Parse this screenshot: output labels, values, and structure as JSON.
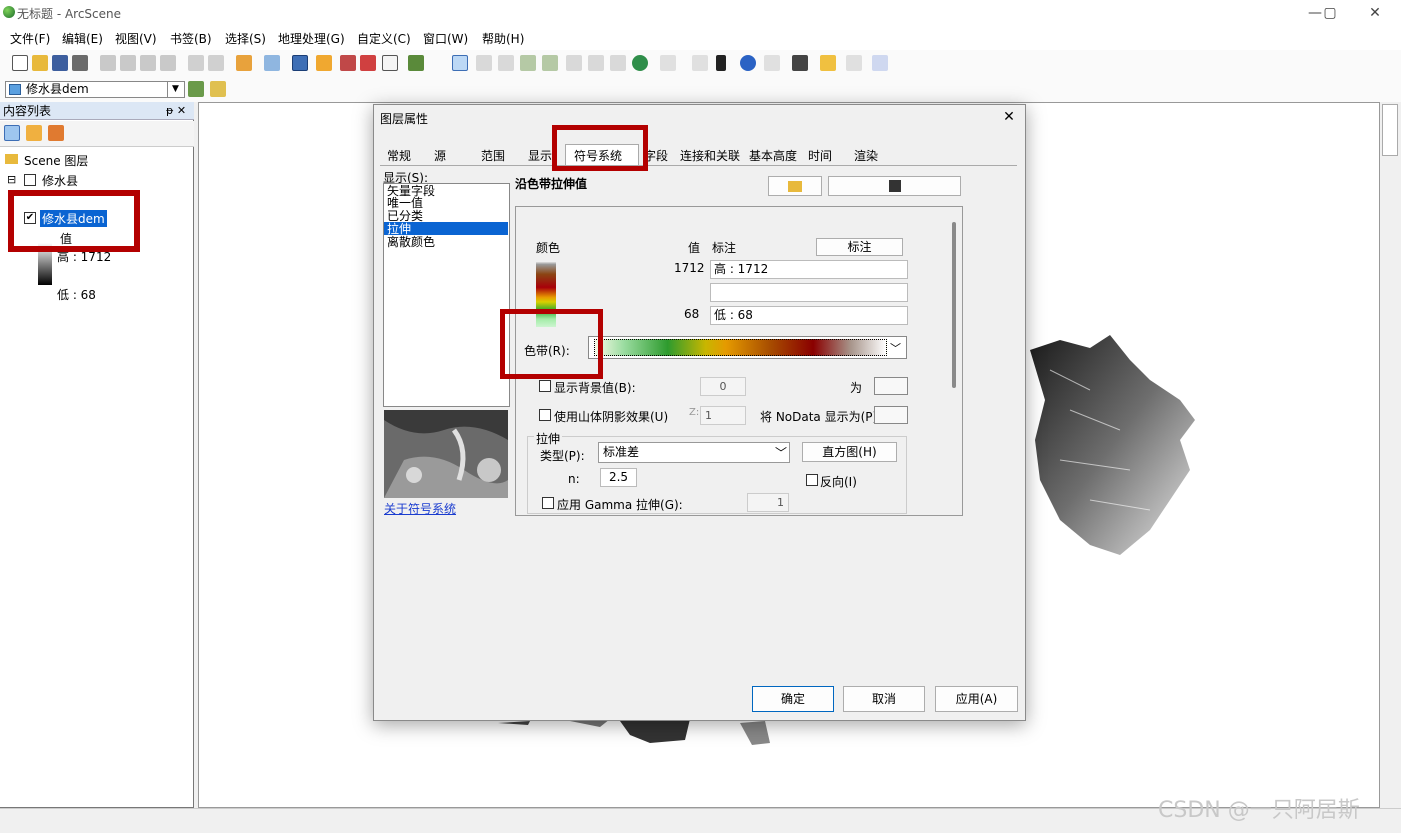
{
  "window": {
    "title": "无标题 - ArcScene",
    "minimize": "—",
    "restore": "▢",
    "close": "✕"
  },
  "menu": [
    "文件(F)",
    "编辑(E)",
    "视图(V)",
    "书签(B)",
    "选择(S)",
    "地理处理(G)",
    "自定义(C)",
    "窗口(W)",
    "帮助(H)"
  ],
  "toolbar": {
    "layer_select": "修水县dem"
  },
  "toc": {
    "title": "内容列表",
    "pin": "ᵽ ✕",
    "root": "Scene 图层",
    "group": "修水县",
    "layer": "修水县dem",
    "value_label": "值",
    "high": "高 : 1712",
    "low": "低 : 68"
  },
  "dialog": {
    "title": "图层属性",
    "close": "✕",
    "tabs": [
      "常规",
      "源",
      "范围",
      "显示",
      "符号系统",
      "字段",
      "连接和关联",
      "基本高度",
      "时间",
      "渲染"
    ],
    "active_tab": "符号系统",
    "show_label": "显示(S):",
    "show_list": [
      "矢量字段",
      "唯一值",
      "已分类",
      "拉伸",
      "离散颜色"
    ],
    "selected_item": "拉伸",
    "about_link": "关于符号系统",
    "ramp_heading": "沿色带拉伸值",
    "col_color": "颜色",
    "col_value": "值",
    "col_label": "标注",
    "label_button": "标注",
    "high_value": "1712",
    "high_label": "高 : 1712",
    "mid_label": "",
    "low_value": "68",
    "low_label": "低 : 68",
    "color_ramp_label": "色带(R):",
    "show_background_label": "显示背景值(B):",
    "background_value": "0",
    "as_label": "为",
    "hillshade_label": "使用山体阴影效果(U)",
    "z_label": "Z:",
    "z_value": "1",
    "nodata_label": "将 NoData 显示为(P)",
    "stretch_group": "拉伸",
    "type_label": "类型(P):",
    "type_value": "标准差",
    "histogram_button": "直方图(H)",
    "n_label": "n:",
    "n_value": "2.5",
    "invert_label": "反向(I)",
    "gamma_label": "应用 Gamma 拉伸(G):",
    "gamma_value": "1",
    "ok": "确定",
    "cancel": "取消",
    "apply": "应用(A)"
  },
  "watermark": "CSDN @一只阿居斯"
}
